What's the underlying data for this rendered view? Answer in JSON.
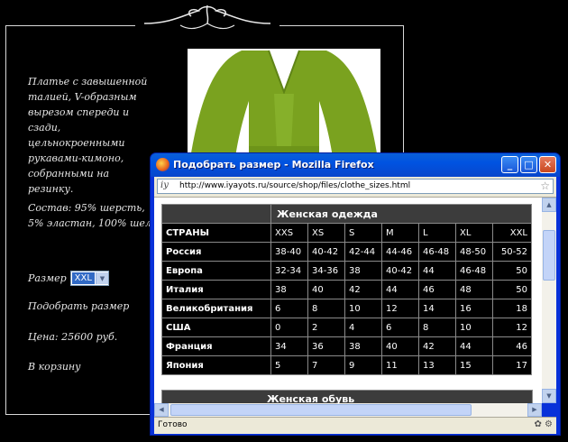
{
  "product": {
    "description": "Платье с завышенной талией, V-образным вырезом спереди и сзади, цельнокроенными рукавами-кимоно, собранными на резинку.",
    "composition": "Состав: 95% шерсть, 5% эластан, 100% шелк",
    "size_label": "Размер",
    "size_value": "XXL",
    "pick_size_link": "Подобрать размер",
    "price": "Цена: 25600 руб.",
    "cart_link": "В корзину"
  },
  "popup": {
    "title": "Подобрать размер - Mozilla Firefox",
    "url": "http://www.iyayots.ru/source/shop/files/clothe_sizes.html",
    "status": "Готово",
    "table": {
      "caption": "Женская одежда",
      "header_label": "СТРАНЫ",
      "sizes": [
        "XXS",
        "XS",
        "S",
        "M",
        "L",
        "XL",
        "XXL"
      ],
      "rows": [
        {
          "country": "Россия",
          "values": [
            "38-40",
            "40-42",
            "42-44",
            "44-46",
            "46-48",
            "48-50",
            "50-52"
          ]
        },
        {
          "country": "Европа",
          "values": [
            "32-34",
            "34-36",
            "38",
            "40-42",
            "44",
            "46-48",
            "50"
          ]
        },
        {
          "country": "Италия",
          "values": [
            "38",
            "40",
            "42",
            "44",
            "46",
            "48",
            "50"
          ]
        },
        {
          "country": "Великобритания",
          "values": [
            "6",
            "8",
            "10",
            "12",
            "14",
            "16",
            "18"
          ]
        },
        {
          "country": "США",
          "values": [
            "0",
            "2",
            "4",
            "6",
            "8",
            "10",
            "12"
          ]
        },
        {
          "country": "Франция",
          "values": [
            "34",
            "36",
            "38",
            "40",
            "42",
            "44",
            "46"
          ]
        },
        {
          "country": "Япония",
          "values": [
            "5",
            "7",
            "9",
            "11",
            "13",
            "15",
            "17"
          ]
        }
      ],
      "next_caption": "Женская обувь"
    }
  },
  "icons": {
    "firefox": "firefox-icon",
    "minimize": "minimize-icon",
    "maximize": "maximize-icon",
    "close": "close-icon",
    "bookmark": "star-icon"
  }
}
